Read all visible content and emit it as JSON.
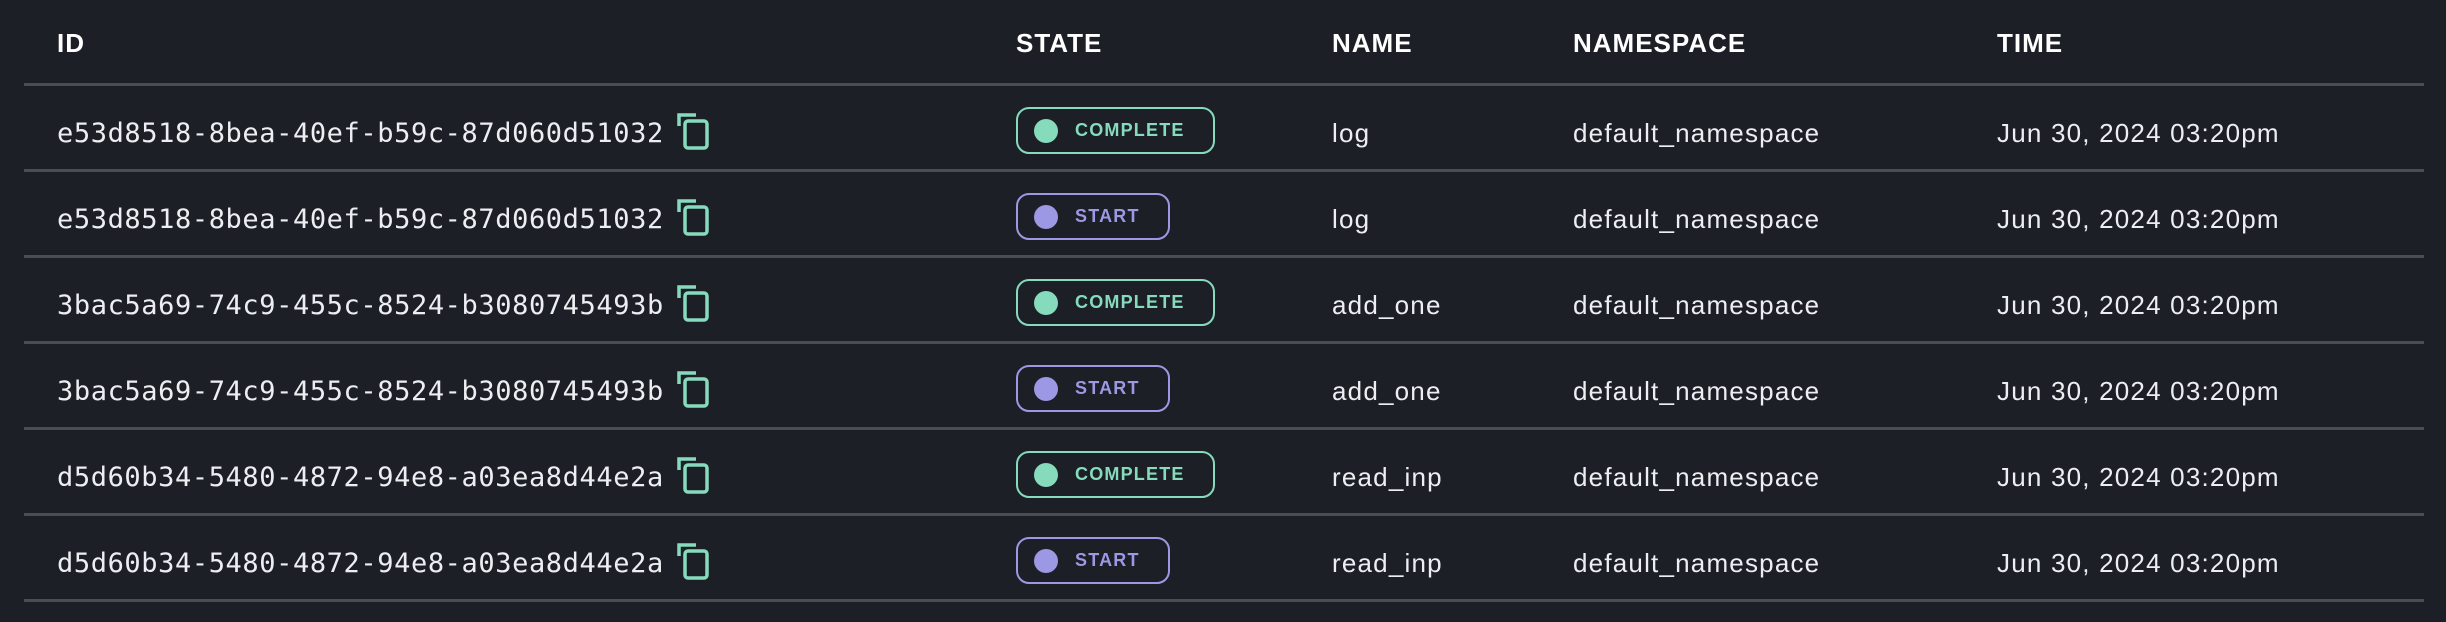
{
  "table": {
    "columns": {
      "id": "ID",
      "state": "STATE",
      "name": "NAME",
      "namespace": "NAMESPACE",
      "time": "TIME"
    },
    "colors": {
      "complete": "#86dbbd",
      "start": "#9c98e3",
      "copy_icon": "#86dbbd",
      "background": "#1c1f26"
    },
    "rows": [
      {
        "id": "e53d8518-8bea-40ef-b59c-87d060d51032",
        "state": "COMPLETE",
        "state_kind": "complete",
        "name": "log",
        "namespace": "default_namespace",
        "time": "Jun 30, 2024 03:20pm",
        "copy_icon": "copy-icon"
      },
      {
        "id": "e53d8518-8bea-40ef-b59c-87d060d51032",
        "state": "START",
        "state_kind": "start",
        "name": "log",
        "namespace": "default_namespace",
        "time": "Jun 30, 2024 03:20pm",
        "copy_icon": "copy-icon"
      },
      {
        "id": "3bac5a69-74c9-455c-8524-b3080745493b",
        "state": "COMPLETE",
        "state_kind": "complete",
        "name": "add_one",
        "namespace": "default_namespace",
        "time": "Jun 30, 2024 03:20pm",
        "copy_icon": "copy-icon"
      },
      {
        "id": "3bac5a69-74c9-455c-8524-b3080745493b",
        "state": "START",
        "state_kind": "start",
        "name": "add_one",
        "namespace": "default_namespace",
        "time": "Jun 30, 2024 03:20pm",
        "copy_icon": "copy-icon"
      },
      {
        "id": "d5d60b34-5480-4872-94e8-a03ea8d44e2a",
        "state": "COMPLETE",
        "state_kind": "complete",
        "name": "read_inp",
        "namespace": "default_namespace",
        "time": "Jun 30, 2024 03:20pm",
        "copy_icon": "copy-icon"
      },
      {
        "id": "d5d60b34-5480-4872-94e8-a03ea8d44e2a",
        "state": "START",
        "state_kind": "start",
        "name": "read_inp",
        "namespace": "default_namespace",
        "time": "Jun 30, 2024 03:20pm",
        "copy_icon": "copy-icon"
      }
    ]
  }
}
